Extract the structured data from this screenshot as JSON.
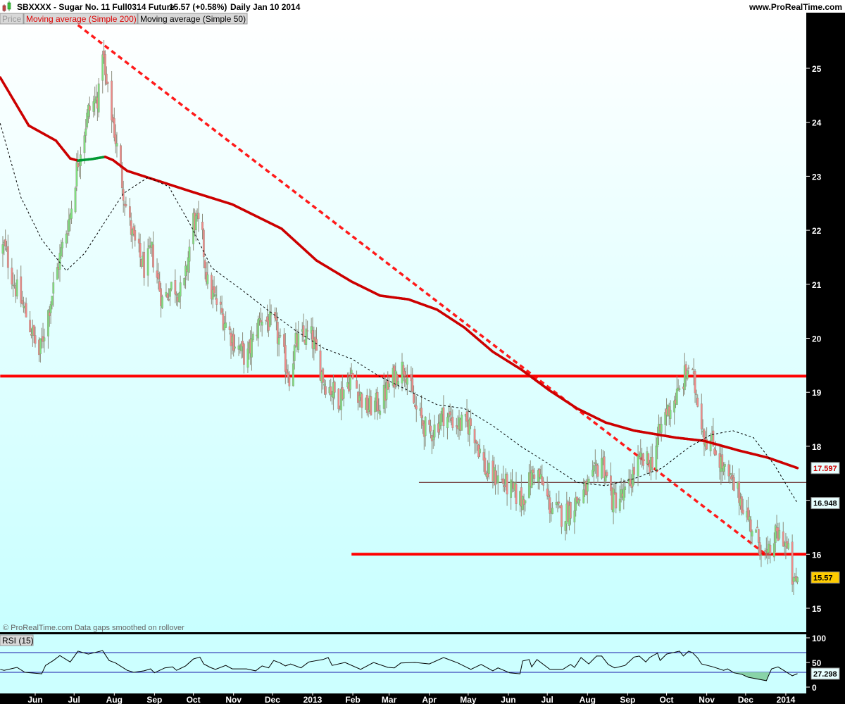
{
  "header": {
    "symbol_title": "SBXXXX - Sugar No. 11 Full0314 Future",
    "last_price": "15.57 (+0.58%)",
    "period_date": "Daily  Jan 10 2014",
    "website": "www.ProRealTime.com"
  },
  "legend": {
    "price": "Price",
    "ma200": "Moving average (Simple 200)",
    "ma50": "Moving average (Simple 50)"
  },
  "footnote": "© ProRealTime.com  Data gaps smoothed on rollover",
  "rsi_label": "RSI (15)",
  "colors": {
    "up": "#7ee07e",
    "down": "#f08a8a",
    "wick": "#8c8c7c",
    "ma200_down": "#cc0000",
    "ma200_up": "#009933",
    "ma50": "#000000",
    "trendline": "#ff1a1a",
    "rsi_band": "#1a1aaa",
    "last_badge": "#ffcc00"
  },
  "chart_data": [
    {
      "type": "candlestick",
      "title": "SBXXXX - Sugar No. 11 Full0314 Future, Daily",
      "x_unit": "calendar days since 2012-06-01",
      "x_range": [
        -27,
        588
      ],
      "ylim": [
        14.6,
        26.0
      ],
      "y_ticks": [
        "15",
        "16",
        "17",
        "18",
        "19",
        "20",
        "21",
        "22",
        "23",
        "24",
        "25"
      ],
      "x_ticks": [
        {
          "label": "Jun",
          "day": 0
        },
        {
          "label": "Jul",
          "day": 30
        },
        {
          "label": "Aug",
          "day": 61
        },
        {
          "label": "Sep",
          "day": 92
        },
        {
          "label": "Oct",
          "day": 122
        },
        {
          "label": "Nov",
          "day": 153
        },
        {
          "label": "Dec",
          "day": 183
        },
        {
          "label": "2013",
          "day": 214
        },
        {
          "label": "Feb",
          "day": 245
        },
        {
          "label": "Mar",
          "day": 273
        },
        {
          "label": "Apr",
          "day": 304
        },
        {
          "label": "May",
          "day": 334
        },
        {
          "label": "Jun",
          "day": 365
        },
        {
          "label": "Jul",
          "day": 395
        },
        {
          "label": "Aug",
          "day": 426
        },
        {
          "label": "Sep",
          "day": 457
        },
        {
          "label": "Oct",
          "day": 487
        },
        {
          "label": "Nov",
          "day": 518
        },
        {
          "label": "Dec",
          "day": 548
        },
        {
          "label": "2014",
          "day": 579
        }
      ],
      "close_path": [
        [
          -27,
          21.6
        ],
        [
          -24,
          21.7
        ],
        [
          -16,
          21.0
        ],
        [
          -5,
          20.3
        ],
        [
          3,
          19.7
        ],
        [
          11,
          20.6
        ],
        [
          19,
          21.5
        ],
        [
          27,
          22.3
        ],
        [
          33,
          23.3
        ],
        [
          41,
          24.2
        ],
        [
          49,
          24.5
        ],
        [
          52,
          25.4
        ],
        [
          54,
          24.8
        ],
        [
          60,
          24.0
        ],
        [
          65,
          23.2
        ],
        [
          71,
          22.3
        ],
        [
          76,
          21.8
        ],
        [
          84,
          21.3
        ],
        [
          90,
          21.6
        ],
        [
          98,
          20.7
        ],
        [
          106,
          21.0
        ],
        [
          114,
          20.8
        ],
        [
          122,
          22.2
        ],
        [
          128,
          22.0
        ],
        [
          133,
          21.0
        ],
        [
          141,
          20.6
        ],
        [
          152,
          20.0
        ],
        [
          163,
          19.6
        ],
        [
          174,
          20.4
        ],
        [
          185,
          20.2
        ],
        [
          196,
          19.3
        ],
        [
          201,
          19.9
        ],
        [
          212,
          20.1
        ],
        [
          223,
          19.2
        ],
        [
          234,
          18.9
        ],
        [
          244,
          19.3
        ],
        [
          255,
          18.7
        ],
        [
          266,
          18.8
        ],
        [
          277,
          19.3
        ],
        [
          285,
          19.5
        ],
        [
          293,
          18.7
        ],
        [
          304,
          18.2
        ],
        [
          315,
          18.6
        ],
        [
          326,
          18.4
        ],
        [
          337,
          18.4
        ],
        [
          348,
          17.5
        ],
        [
          358,
          17.4
        ],
        [
          375,
          17.0
        ],
        [
          386,
          17.6
        ],
        [
          397,
          16.9
        ],
        [
          407,
          16.7
        ],
        [
          418,
          17.0
        ],
        [
          429,
          17.3
        ],
        [
          437,
          17.8
        ],
        [
          445,
          17.0
        ],
        [
          456,
          17.1
        ],
        [
          464,
          17.7
        ],
        [
          475,
          17.7
        ],
        [
          486,
          18.6
        ],
        [
          497,
          19.0
        ],
        [
          504,
          19.5
        ],
        [
          511,
          18.9
        ],
        [
          516,
          18.2
        ],
        [
          524,
          18.0
        ],
        [
          532,
          17.5
        ],
        [
          543,
          17.1
        ],
        [
          551,
          16.6
        ],
        [
          559,
          16.2
        ],
        [
          565,
          15.9
        ],
        [
          570,
          16.3
        ],
        [
          576,
          16.4
        ],
        [
          581,
          16.0
        ],
        [
          585,
          15.4
        ],
        [
          588,
          15.57
        ]
      ],
      "series": [
        {
          "name": "Moving average (Simple 200)",
          "last": "17.597",
          "points": [
            [
              -27,
              24.83
            ],
            [
              -5,
              23.94
            ],
            [
              16,
              23.66
            ],
            [
              27,
              23.33
            ],
            [
              33,
              23.29
            ],
            [
              44,
              23.32
            ],
            [
              54,
              23.36
            ],
            [
              60,
              23.3
            ],
            [
              71,
              23.1
            ],
            [
              120,
              22.72
            ],
            [
              152,
              22.48
            ],
            [
              190,
              22.03
            ],
            [
              217,
              21.44
            ],
            [
              244,
              21.05
            ],
            [
              266,
              20.79
            ],
            [
              288,
              20.72
            ],
            [
              310,
              20.53
            ],
            [
              331,
              20.2
            ],
            [
              353,
              19.75
            ],
            [
              375,
              19.42
            ],
            [
              397,
              19.03
            ],
            [
              418,
              18.7
            ],
            [
              440,
              18.44
            ],
            [
              462,
              18.29
            ],
            [
              494,
              18.16
            ],
            [
              516,
              18.1
            ],
            [
              543,
              17.92
            ],
            [
              565,
              17.79
            ],
            [
              588,
              17.597
            ]
          ]
        },
        {
          "name": "Moving average (Simple 50)",
          "last": "16.948",
          "points": [
            [
              -27,
              23.98
            ],
            [
              -11,
              22.61
            ],
            [
              5,
              21.83
            ],
            [
              24,
              21.25
            ],
            [
              38,
              21.57
            ],
            [
              52,
              22.09
            ],
            [
              68,
              22.68
            ],
            [
              87,
              22.98
            ],
            [
              103,
              22.81
            ],
            [
              120,
              22.09
            ],
            [
              136,
              21.31
            ],
            [
              158,
              20.92
            ],
            [
              179,
              20.53
            ],
            [
              201,
              20.14
            ],
            [
              223,
              19.81
            ],
            [
              244,
              19.62
            ],
            [
              266,
              19.29
            ],
            [
              288,
              19.03
            ],
            [
              310,
              18.77
            ],
            [
              331,
              18.7
            ],
            [
              353,
              18.38
            ],
            [
              375,
              17.99
            ],
            [
              397,
              17.66
            ],
            [
              418,
              17.33
            ],
            [
              440,
              17.27
            ],
            [
              462,
              17.4
            ],
            [
              483,
              17.59
            ],
            [
              505,
              17.99
            ],
            [
              521,
              18.21
            ],
            [
              538,
              18.29
            ],
            [
              554,
              18.16
            ],
            [
              570,
              17.66
            ],
            [
              588,
              16.948
            ]
          ]
        }
      ],
      "last_close": "15.57",
      "annotations": [
        {
          "type": "dashed-trendline",
          "from": [
            33,
            25.8
          ],
          "to": [
            565,
            15.97
          ]
        },
        {
          "type": "horizontal",
          "price": 19.3,
          "from_day": -27,
          "to_day": 588,
          "weight": "thick"
        },
        {
          "type": "horizontal",
          "price": 16.0,
          "from_day": 244,
          "to_day": 588,
          "weight": "thick"
        },
        {
          "type": "horizontal",
          "price": 17.33,
          "from_day": 296,
          "to_day": 588,
          "weight": "thin"
        }
      ]
    },
    {
      "type": "line",
      "title": "RSI (15)",
      "ylim": [
        0,
        100
      ],
      "y_ticks": [
        "100",
        "50",
        "0"
      ],
      "bands": [
        30,
        70
      ],
      "last": "27.298",
      "points": [
        [
          -27,
          36
        ],
        [
          -24,
          34
        ],
        [
          -14,
          40
        ],
        [
          -8,
          30
        ],
        [
          5,
          27
        ],
        [
          8,
          44
        ],
        [
          14,
          54
        ],
        [
          19,
          64
        ],
        [
          27,
          51
        ],
        [
          33,
          73
        ],
        [
          41,
          67
        ],
        [
          52,
          74
        ],
        [
          54,
          66
        ],
        [
          57,
          54
        ],
        [
          62,
          49
        ],
        [
          71,
          34
        ],
        [
          76,
          30
        ],
        [
          84,
          33
        ],
        [
          89,
          37
        ],
        [
          92,
          29
        ],
        [
          100,
          39
        ],
        [
          106,
          41
        ],
        [
          109,
          34
        ],
        [
          116,
          43
        ],
        [
          122,
          57
        ],
        [
          127,
          61
        ],
        [
          130,
          47
        ],
        [
          135,
          40
        ],
        [
          139,
          36
        ],
        [
          147,
          44
        ],
        [
          152,
          37
        ],
        [
          163,
          37
        ],
        [
          170,
          33
        ],
        [
          175,
          43
        ],
        [
          180,
          39
        ],
        [
          184,
          54
        ],
        [
          189,
          49
        ],
        [
          193,
          43
        ],
        [
          197,
          47
        ],
        [
          205,
          39
        ],
        [
          211,
          51
        ],
        [
          222,
          56
        ],
        [
          226,
          60
        ],
        [
          229,
          44
        ],
        [
          239,
          50
        ],
        [
          251,
          36
        ],
        [
          261,
          50
        ],
        [
          272,
          40
        ],
        [
          277,
          39
        ],
        [
          282,
          49
        ],
        [
          293,
          50
        ],
        [
          304,
          47
        ],
        [
          315,
          60
        ],
        [
          326,
          49
        ],
        [
          336,
          36
        ],
        [
          344,
          46
        ],
        [
          353,
          33
        ],
        [
          357,
          39
        ],
        [
          366,
          29
        ],
        [
          374,
          27
        ],
        [
          376,
          53
        ],
        [
          381,
          56
        ],
        [
          383,
          41
        ],
        [
          387,
          56
        ],
        [
          397,
          36
        ],
        [
          407,
          36
        ],
        [
          413,
          46
        ],
        [
          416,
          40
        ],
        [
          421,
          60
        ],
        [
          427,
          47
        ],
        [
          433,
          63
        ],
        [
          437,
          63
        ],
        [
          442,
          46
        ],
        [
          447,
          39
        ],
        [
          455,
          44
        ],
        [
          462,
          61
        ],
        [
          466,
          63
        ],
        [
          471,
          51
        ],
        [
          474,
          60
        ],
        [
          480,
          69
        ],
        [
          482,
          54
        ],
        [
          487,
          67
        ],
        [
          497,
          73
        ],
        [
          500,
          63
        ],
        [
          504,
          73
        ],
        [
          507,
          70
        ],
        [
          511,
          59
        ],
        [
          514,
          47
        ],
        [
          523,
          41
        ],
        [
          531,
          34
        ],
        [
          534,
          37
        ],
        [
          539,
          29
        ],
        [
          545,
          26
        ],
        [
          550,
          20
        ],
        [
          564,
          13
        ],
        [
          568,
          37
        ],
        [
          573,
          41
        ],
        [
          578,
          33
        ],
        [
          584,
          23
        ],
        [
          588,
          27.3
        ]
      ]
    }
  ]
}
